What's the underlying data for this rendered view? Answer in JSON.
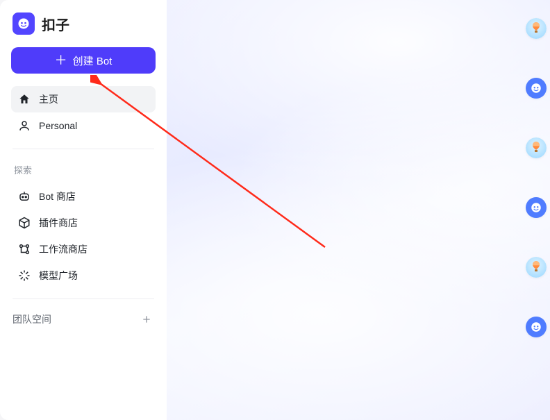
{
  "brand": {
    "name": "扣子"
  },
  "create_button": {
    "label": "创建 Bot"
  },
  "nav": {
    "home_label": "主页",
    "personal_label": "Personal"
  },
  "explore": {
    "title": "探索",
    "bot_store_label": "Bot 商店",
    "plugin_store_label": "插件商店",
    "workflow_store_label": "工作流商店",
    "model_plaza_label": "模型广场"
  },
  "team": {
    "title": "团队空间"
  },
  "floating": {
    "items": [
      {
        "type": "balloon"
      },
      {
        "type": "bot"
      },
      {
        "type": "balloon"
      },
      {
        "type": "bot"
      },
      {
        "type": "balloon"
      },
      {
        "type": "bot"
      }
    ]
  },
  "colors": {
    "primary": "#4f3cfa",
    "brand": "#5245ff",
    "bot_avatar": "#4f7cff",
    "arrow": "#ff2a1a"
  }
}
